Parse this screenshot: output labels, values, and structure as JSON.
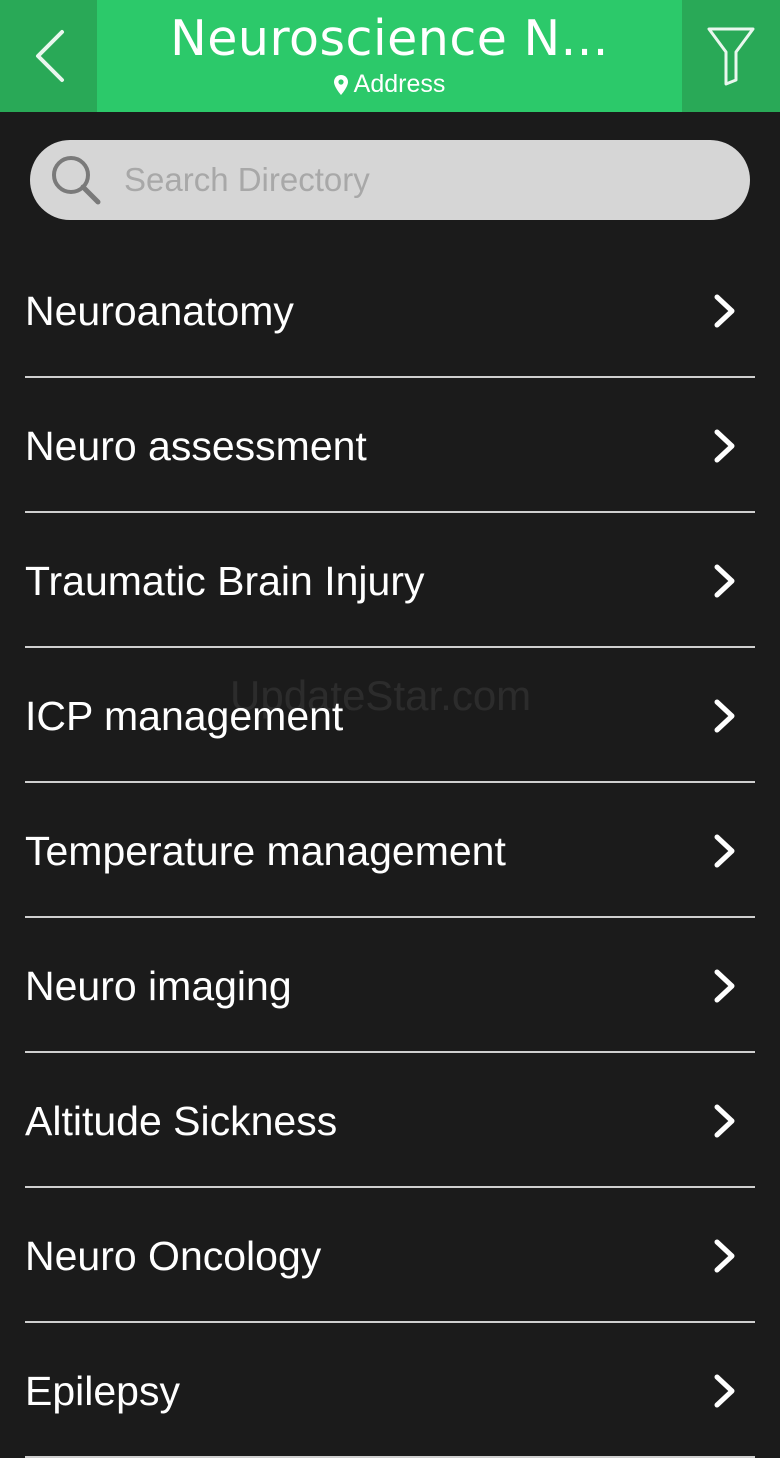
{
  "header": {
    "title": "Neuroscience N...",
    "subtitle": "Address",
    "accent": "#2cc96a",
    "side_color": "#29a957"
  },
  "search": {
    "placeholder": "Search Directory"
  },
  "list": {
    "items": [
      {
        "label": "Neuroanatomy"
      },
      {
        "label": "Neuro assessment"
      },
      {
        "label": "Traumatic Brain Injury"
      },
      {
        "label": "ICP management"
      },
      {
        "label": "Temperature management"
      },
      {
        "label": "Neuro imaging"
      },
      {
        "label": "Altitude Sickness"
      },
      {
        "label": "Neuro Oncology"
      },
      {
        "label": "Epilepsy"
      }
    ]
  },
  "watermark": "UpdateStar.com",
  "icons": {
    "back": "chevron-left-icon",
    "filter": "filter-icon",
    "location": "map-pin-icon",
    "search": "search-icon",
    "row": "chevron-right-icon"
  }
}
